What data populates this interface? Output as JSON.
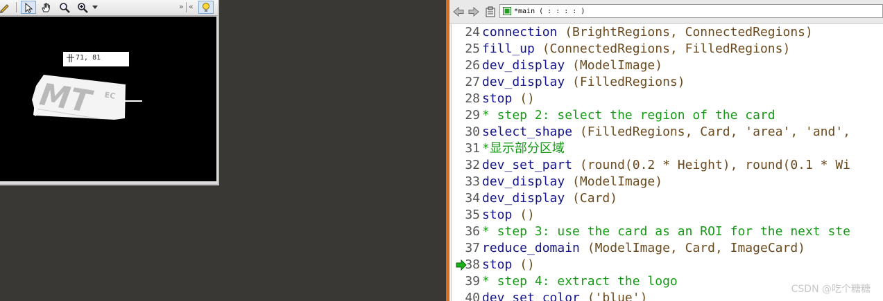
{
  "graphics_window": {
    "toolbar": {
      "items": [
        {
          "name": "pencil-icon"
        },
        {
          "name": "pointer-icon"
        },
        {
          "name": "hand-icon"
        },
        {
          "name": "magnify-icon"
        },
        {
          "name": "zoom-in-icon"
        },
        {
          "name": "dropdown-arrow-icon"
        },
        {
          "name": "overflow-chevron-icon"
        },
        {
          "name": "lightbulb-icon"
        }
      ],
      "overflow_right": "»",
      "overflow_left": "«"
    },
    "pixel_info": "71, 81",
    "logo_text": "MT",
    "logo_sup": "EC"
  },
  "editor": {
    "toolbar": {
      "back_icon": "back-arrow-icon",
      "forward_icon": "forward-arrow-icon",
      "clipboard_icon": "clipboard-icon",
      "procedure": "*main ( : : : : )"
    },
    "lines": [
      {
        "n": "24",
        "op": "connection",
        "args": " (BrightRegions, ConnectedRegions)",
        "type": "op"
      },
      {
        "n": "25",
        "op": "fill_up",
        "args": " (ConnectedRegions, FilledRegions)",
        "type": "op"
      },
      {
        "n": "26",
        "op": "dev_display",
        "args": " (ModelImage)",
        "type": "op"
      },
      {
        "n": "27",
        "op": "dev_display",
        "args": " (FilledRegions)",
        "type": "op"
      },
      {
        "n": "28",
        "op": "stop",
        "args": " ()",
        "type": "op"
      },
      {
        "n": "29",
        "op": "* step 2: select the region of the card",
        "args": "",
        "type": "cmt"
      },
      {
        "n": "30",
        "op": "select_shape",
        "args": " (FilledRegions, Card, 'area', 'and',",
        "type": "op"
      },
      {
        "n": "31",
        "op": "*显示部分区域",
        "args": "",
        "type": "cmt"
      },
      {
        "n": "32",
        "op": "dev_set_part",
        "args": " (round(0.2 * Height), round(0.1 * Wi",
        "type": "op"
      },
      {
        "n": "33",
        "op": "dev_display",
        "args": " (ModelImage)",
        "type": "op"
      },
      {
        "n": "34",
        "op": "dev_display",
        "args": " (Card)",
        "type": "op"
      },
      {
        "n": "35",
        "op": "stop",
        "args": " ()",
        "type": "op"
      },
      {
        "n": "36",
        "op": "* step 3: use the card as an ROI for the next ste",
        "args": "",
        "type": "cmt"
      },
      {
        "n": "37",
        "op": "reduce_domain",
        "args": " (ModelImage, Card, ImageCard)",
        "type": "op"
      },
      {
        "n": "38",
        "op": "stop",
        "args": " ()",
        "type": "op"
      },
      {
        "n": "39",
        "op": "* step 4: extract the logo",
        "args": "",
        "type": "cmt"
      },
      {
        "n": "40",
        "op": "dev_set_color",
        "args": " ('blue')",
        "type": "op"
      }
    ],
    "program_counter_line": "38"
  },
  "watermark": "CSDN @吃个糖糖",
  "colors": {
    "operator": "#14148a",
    "arguments": "#6b4a1e",
    "comment": "#169a16",
    "splitter": "#d46f1f",
    "background": "#3a3835"
  }
}
